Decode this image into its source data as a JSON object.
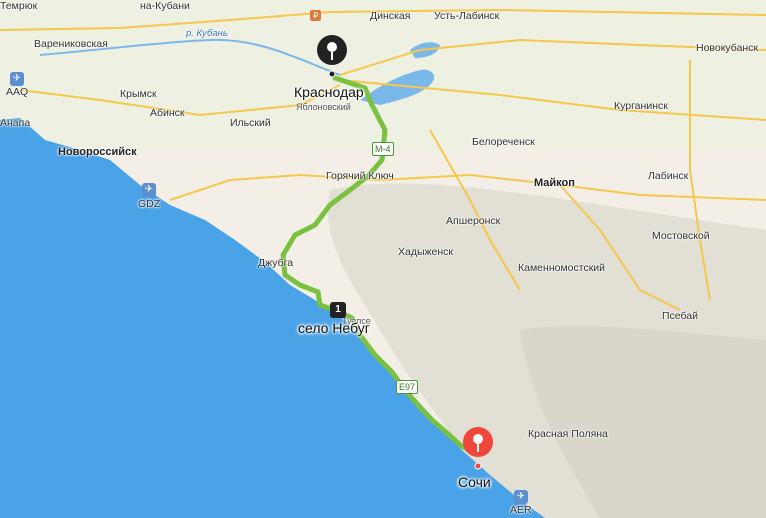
{
  "map": {
    "route_color": "#7ac142",
    "sea_color": "#4aa3e6",
    "land_color": "#f3efe6",
    "mountain_color": "#e3e0d6"
  },
  "start": {
    "label": "Краснодар",
    "pin_icon": "black-pin-icon",
    "sublabel": "Яблоновский"
  },
  "end": {
    "label": "Сочи",
    "pin_icon": "red-pin-icon"
  },
  "waypoint": {
    "number": "1",
    "label": "село Небуг"
  },
  "cities": {
    "na_kubani": "на-Кубани",
    "dinskaya": "Динская",
    "ust_labinsk": "Усть-Лабинск",
    "temryuk": "Темрюк",
    "varenikovskaya": "Варениковская",
    "novokubansk": "Новокубанск",
    "krymsk": "Крымск",
    "abinsk": "Абинск",
    "ilsky": "Ильский",
    "anapa": "Анапа",
    "kurganinsk": "Курганинск",
    "novorossiysk": "Новороссийск",
    "belorechensk": "Белореченск",
    "goryachy_klyuch": "Горячий Ключ",
    "maykop": "Майкоп",
    "labinsk": "Лабинск",
    "apsheronsk": "Апшеронск",
    "khadyzhensk": "Хадыженск",
    "mostovskoy": "Мостовской",
    "dzhubga": "Джубга",
    "kamennomostsky": "Каменномостский",
    "psebay": "Псебай",
    "tuapse": "Туапсе",
    "krasnaya_polyana": "Красная Поляна"
  },
  "river": "р. Кубань",
  "airports": {
    "aaq": "AAQ",
    "gdz": "GDZ",
    "aer": "AER"
  },
  "roads": {
    "m4": "М-4",
    "e97": "E97"
  },
  "icons": {
    "airport": "airplane-icon",
    "poi": "poi-icon"
  }
}
